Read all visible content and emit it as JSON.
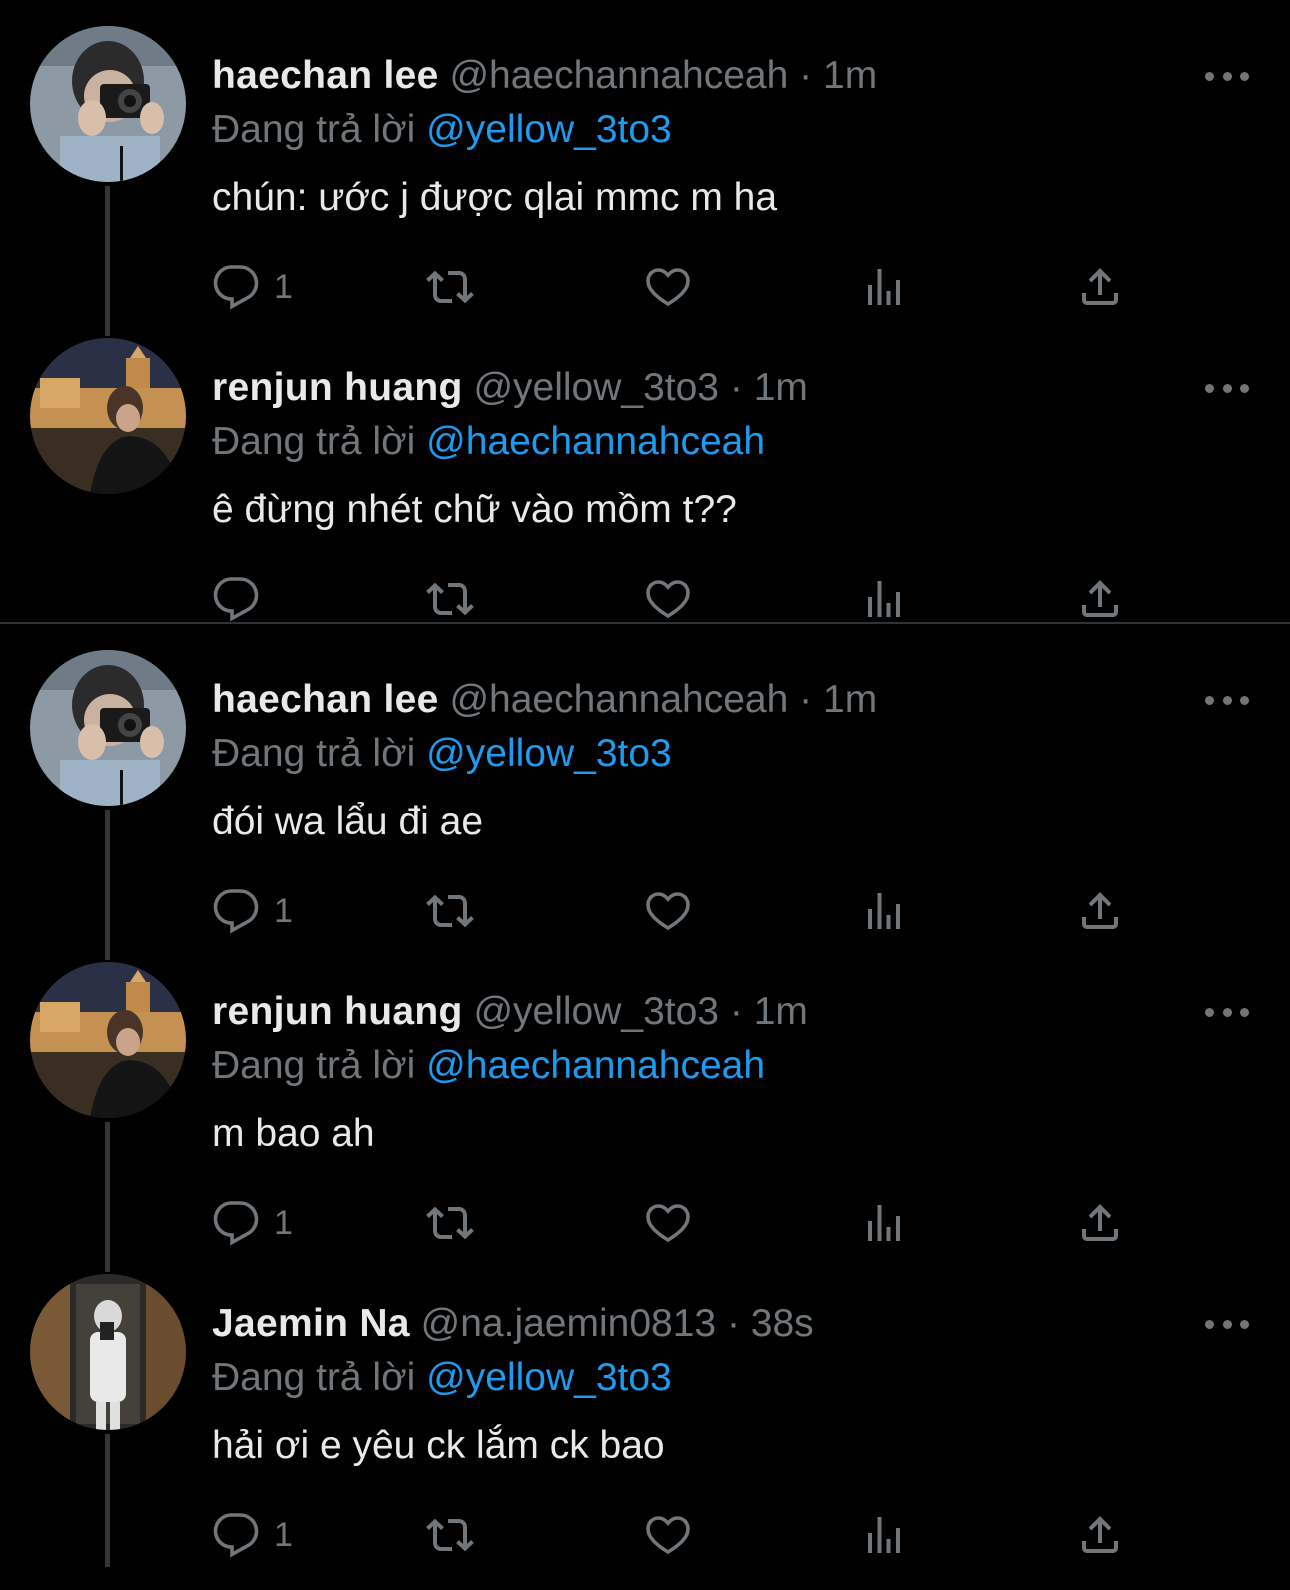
{
  "reply_label": "Đang trả lời",
  "tweets": [
    {
      "name": "haechan lee",
      "handle": "@haechannahceah",
      "time": "1m",
      "replying_to": "@yellow_3to3",
      "text": "chún: ước j được qlai mmc m ha",
      "reply_count": "1"
    },
    {
      "name": "renjun huang",
      "handle": "@yellow_3to3",
      "time": "1m",
      "replying_to": "@haechannahceah",
      "text": "ê đừng nhét chữ vào mồm t??",
      "reply_count": ""
    },
    {
      "name": "haechan lee",
      "handle": "@haechannahceah",
      "time": "1m",
      "replying_to": "@yellow_3to3",
      "text": "đói wa lẩu đi ae",
      "reply_count": "1"
    },
    {
      "name": "renjun huang",
      "handle": "@yellow_3to3",
      "time": "1m",
      "replying_to": "@haechannahceah",
      "text": "m bao ah",
      "reply_count": "1"
    },
    {
      "name": "Jaemin Na",
      "handle": "@na.jaemin0813",
      "time": "38s",
      "replying_to": "@yellow_3to3",
      "text": "hải ơi e yêu ck lắm ck bao",
      "reply_count": "1"
    }
  ],
  "icons": [
    "reply-icon",
    "retweet-icon",
    "like-icon",
    "views-icon",
    "share-icon",
    "more-icon"
  ],
  "colors": {
    "background": "#000000",
    "text": "#e7e9ea",
    "muted": "#71767b",
    "link": "#1d9bf0",
    "line": "#333639"
  }
}
